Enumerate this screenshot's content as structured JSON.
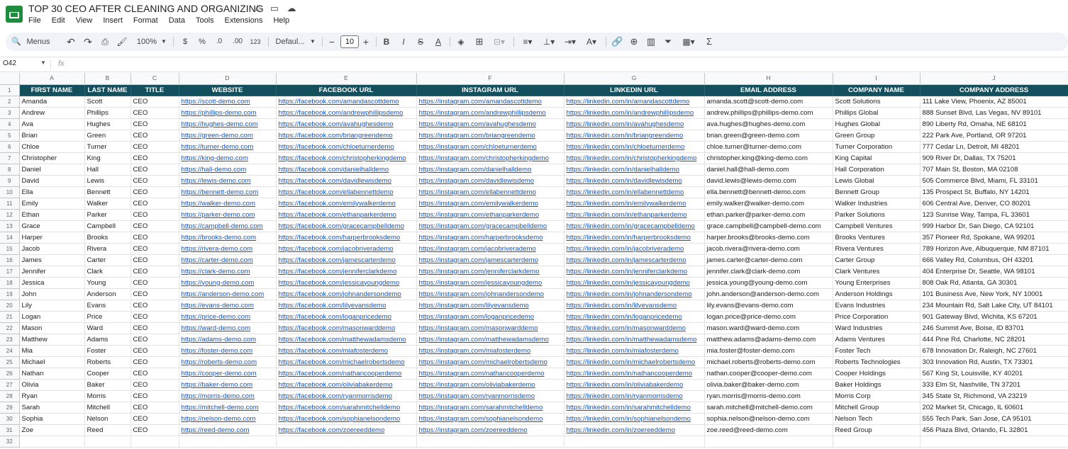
{
  "doc_title": "TOP 30 CEO AFTER CLEANING AND ORGANIZING",
  "menu": [
    "File",
    "Edit",
    "View",
    "Insert",
    "Format",
    "Data",
    "Tools",
    "Extensions",
    "Help"
  ],
  "toolbar": {
    "menus_label": "Menus",
    "zoom": "100%",
    "currency": "$",
    "percent": "%",
    "dec_decrease": ".0",
    "dec_increase": ".00",
    "number_format": "123",
    "font": "Defaul...",
    "font_size": "10",
    "bold": "B",
    "italic": "I"
  },
  "name_box": "O42",
  "fx": "fx",
  "columns": [
    "A",
    "B",
    "C",
    "D",
    "E",
    "F",
    "G",
    "H",
    "I",
    "J"
  ],
  "headers": [
    "FIRST NAME",
    "LAST NAME",
    "TITLE",
    "WEBSITE",
    "FACEBOOK URL",
    "INSTAGRAM URL",
    "LINKEDIN URL",
    "EMAIL ADDRESS",
    "COMPANY NAME",
    "COMPANY ADDRESS"
  ],
  "rows": [
    [
      "Amanda",
      "Scott",
      "CEO",
      "https://scott-demo.com",
      "https://facebook.com/amandascottdemo",
      "https://instagram.com/amandascottdemo",
      "https://linkedin.com/in/amandascottdemo",
      "amanda.scott@scott-demo.com",
      "Scott Solutions",
      "111 Lake View, Phoenix, AZ 85001"
    ],
    [
      "Andrew",
      "Phillips",
      "CEO",
      "https://phillips-demo.com",
      "https://facebook.com/andrewphillipsdemo",
      "https://instagram.com/andrewphillipsdemo",
      "https://linkedin.com/in/andrewphillipsdemo",
      "andrew.phillips@phillips-demo.com",
      "Phillips Global",
      "888 Sunset Blvd, Las Vegas, NV 89101"
    ],
    [
      "Ava",
      "Hughes",
      "CEO",
      "https://hughes-demo.com",
      "https://facebook.com/avahughesdemo",
      "https://instagram.com/avahughesdemo",
      "https://linkedin.com/in/avahughesdemo",
      "ava.hughes@hughes-demo.com",
      "Hughes Global",
      "890 Liberty Rd, Omaha, NE 68101"
    ],
    [
      "Brian",
      "Green",
      "CEO",
      "https://green-demo.com",
      "https://facebook.com/briangreendemo",
      "https://instagram.com/briangreendemo",
      "https://linkedin.com/in/briangreendemo",
      "brian.green@green-demo.com",
      "Green Group",
      "222 Park Ave, Portland, OR 97201"
    ],
    [
      "Chloe",
      "Turner",
      "CEO",
      "https://turner-demo.com",
      "https://facebook.com/chloeturnerdemo",
      "https://instagram.com/chloeturnerdemo",
      "https://linkedin.com/in/chloeturnerdemo",
      "chloe.turner@turner-demo.com",
      "Turner Corporation",
      "777 Cedar Ln, Detroit, MI 48201"
    ],
    [
      "Christopher",
      "King",
      "CEO",
      "https://king-demo.com",
      "https://facebook.com/christopherkingdemo",
      "https://instagram.com/christopherkingdemo",
      "https://linkedin.com/in/christopherkingdemo",
      "christopher.king@king-demo.com",
      "King Capital",
      "909 River Dr, Dallas, TX 75201"
    ],
    [
      "Daniel",
      "Hall",
      "CEO",
      "https://hall-demo.com",
      "https://facebook.com/danielhalldemo",
      "https://instagram.com/danielhalldemo",
      "https://linkedin.com/in/danielhalldemo",
      "daniel.hall@hall-demo.com",
      "Hall Corporation",
      "707 Main St, Boston, MA 02108"
    ],
    [
      "David",
      "Lewis",
      "CEO",
      "https://lewis-demo.com",
      "https://facebook.com/davidlewisdemo",
      "https://instagram.com/davidlewisdemo",
      "https://linkedin.com/in/davidlewisdemo",
      "david.lewis@lewis-demo.com",
      "Lewis Global",
      "505 Commerce Blvd, Miami, FL 33101"
    ],
    [
      "Ella",
      "Bennett",
      "CEO",
      "https://bennett-demo.com",
      "https://facebook.com/ellabennettdemo",
      "https://instagram.com/ellabennettdemo",
      "https://linkedin.com/in/ellabennettdemo",
      "ella.bennett@bennett-demo.com",
      "Bennett Group",
      "135 Prospect St, Buffalo, NY 14201"
    ],
    [
      "Emily",
      "Walker",
      "CEO",
      "https://walker-demo.com",
      "https://facebook.com/emilywalkerdemo",
      "https://instagram.com/emilywalkerdemo",
      "https://linkedin.com/in/emilywalkerdemo",
      "emily.walker@walker-demo.com",
      "Walker Industries",
      "606 Central Ave, Denver, CO 80201"
    ],
    [
      "Ethan",
      "Parker",
      "CEO",
      "https://parker-demo.com",
      "https://facebook.com/ethanparkerdemo",
      "https://instagram.com/ethanparkerdemo",
      "https://linkedin.com/in/ethanparkerdemo",
      "ethan.parker@parker-demo.com",
      "Parker Solutions",
      "123 Sunrise Way, Tampa, FL 33601"
    ],
    [
      "Grace",
      "Campbell",
      "CEO",
      "https://campbell-demo.com",
      "https://facebook.com/gracecampbelldemo",
      "https://instagram.com/gracecampbelldemo",
      "https://linkedin.com/in/gracecampbelldemo",
      "grace.campbell@campbell-demo.com",
      "Campbell Ventures",
      "999 Harbor Dr, San Diego, CA 92101"
    ],
    [
      "Harper",
      "Brooks",
      "CEO",
      "https://brooks-demo.com",
      "https://facebook.com/harperbrooksdemo",
      "https://instagram.com/harperbrooksdemo",
      "https://linkedin.com/in/harperbrooksdemo",
      "harper.brooks@brooks-demo.com",
      "Brooks Ventures",
      "357 Pioneer Rd, Spokane, WA 99201"
    ],
    [
      "Jacob",
      "Rivera",
      "CEO",
      "https://rivera-demo.com",
      "https://facebook.com/jacobriverademo",
      "https://instagram.com/jacobriverademo",
      "https://linkedin.com/in/jacobriverademo",
      "jacob.rivera@rivera-demo.com",
      "Rivera Ventures",
      "789 Horizon Ave, Albuquerque, NM 87101"
    ],
    [
      "James",
      "Carter",
      "CEO",
      "https://carter-demo.com",
      "https://facebook.com/jamescarterdemo",
      "https://instagram.com/jamescarterdemo",
      "https://linkedin.com/in/jamescarterdemo",
      "james.carter@carter-demo.com",
      "Carter Group",
      "666 Valley Rd, Columbus, OH 43201"
    ],
    [
      "Jennifer",
      "Clark",
      "CEO",
      "https://clark-demo.com",
      "https://facebook.com/jenniferclarkdemo",
      "https://instagram.com/jenniferclarkdemo",
      "https://linkedin.com/in/jenniferclarkdemo",
      "jennifer.clark@clark-demo.com",
      "Clark Ventures",
      "404 Enterprise Dr, Seattle, WA 98101"
    ],
    [
      "Jessica",
      "Young",
      "CEO",
      "https://young-demo.com",
      "https://facebook.com/jessicayoungdemo",
      "https://instagram.com/jessicayoungdemo",
      "https://linkedin.com/in/jessicayoungdemo",
      "jessica.young@young-demo.com",
      "Young Enterprises",
      "808 Oak Rd, Atlanta, GA 30301"
    ],
    [
      "John",
      "Anderson",
      "CEO",
      "https://anderson-demo.com",
      "https://facebook.com/johnandersondemo",
      "https://instagram.com/johnandersondemo",
      "https://linkedin.com/in/johnandersondemo",
      "john.anderson@anderson-demo.com",
      "Anderson Holdings",
      "101 Business Ave, New York, NY 10001"
    ],
    [
      "Lily",
      "Evans",
      "CEO",
      "https://evans-demo.com",
      "https://facebook.com/lilyevansdemo",
      "https://instagram.com/lilyevansdemo",
      "https://linkedin.com/in/lilyevansdemo",
      "lily.evans@evans-demo.com",
      "Evans Industries",
      "234 Mountain Rd, Salt Lake City, UT 84101"
    ],
    [
      "Logan",
      "Price",
      "CEO",
      "https://price-demo.com",
      "https://facebook.com/loganpricedemo",
      "https://instagram.com/loganpricedemo",
      "https://linkedin.com/in/loganpricedemo",
      "logan.price@price-demo.com",
      "Price Corporation",
      "901 Gateway Blvd, Wichita, KS 67201"
    ],
    [
      "Mason",
      "Ward",
      "CEO",
      "https://ward-demo.com",
      "https://facebook.com/masonwarddemo",
      "https://instagram.com/masonwarddemo",
      "https://linkedin.com/in/masonwarddemo",
      "mason.ward@ward-demo.com",
      "Ward Industries",
      "246 Summit Ave, Boise, ID 83701"
    ],
    [
      "Matthew",
      "Adams",
      "CEO",
      "https://adams-demo.com",
      "https://facebook.com/matthewadamsdemo",
      "https://instagram.com/matthewadamsdemo",
      "https://linkedin.com/in/matthewadamsdemo",
      "matthew.adams@adams-demo.com",
      "Adams Ventures",
      "444 Pine Rd, Charlotte, NC 28201"
    ],
    [
      "Mia",
      "Foster",
      "CEO",
      "https://foster-demo.com",
      "https://facebook.com/miafosterdemo",
      "https://instagram.com/miafosterdemo",
      "https://linkedin.com/in/miafosterdemo",
      "mia.foster@foster-demo.com",
      "Foster Tech",
      "678 Innovation Dr, Raleigh, NC 27601"
    ],
    [
      "Michael",
      "Roberts",
      "CEO",
      "https://roberts-demo.com",
      "https://facebook.com/michaelrobertsdemo",
      "https://instagram.com/michaelrobertsdemo",
      "https://linkedin.com/in/michaelrobertsdemo",
      "michael.roberts@roberts-demo.com",
      "Roberts Technologies",
      "303 Innovation Rd, Austin, TX 73301"
    ],
    [
      "Nathan",
      "Cooper",
      "CEO",
      "https://cooper-demo.com",
      "https://facebook.com/nathancooperdemo",
      "https://instagram.com/nathancooperdemo",
      "https://linkedin.com/in/nathancooperdemo",
      "nathan.cooper@cooper-demo.com",
      "Cooper Holdings",
      "567 King St, Louisville, KY 40201"
    ],
    [
      "Olivia",
      "Baker",
      "CEO",
      "https://baker-demo.com",
      "https://facebook.com/oliviabakerdemo",
      "https://instagram.com/oliviabakerdemo",
      "https://linkedin.com/in/oliviabakerdemo",
      "olivia.baker@baker-demo.com",
      "Baker Holdings",
      "333 Elm St, Nashville, TN 37201"
    ],
    [
      "Ryan",
      "Morris",
      "CEO",
      "https://morris-demo.com",
      "https://facebook.com/ryanmorrisdemo",
      "https://instagram.com/ryanmorrisdemo",
      "https://linkedin.com/in/ryanmorrisdemo",
      "ryan.morris@morris-demo.com",
      "Morris Corp",
      "345 State St, Richmond, VA 23219"
    ],
    [
      "Sarah",
      "Mitchell",
      "CEO",
      "https://mitchell-demo.com",
      "https://facebook.com/sarahmitchelldemo",
      "https://instagram.com/sarahmitchelldemo",
      "https://linkedin.com/in/sarahmitchelldemo",
      "sarah.mitchell@mitchell-demo.com",
      "Mitchell Group",
      "202 Market St, Chicago, IL 60601"
    ],
    [
      "Sophia",
      "Nelson",
      "CEO",
      "https://nelson-demo.com",
      "https://facebook.com/sophianelsondemo",
      "https://instagram.com/sophianelsondemo",
      "https://linkedin.com/in/sophianelsondemo",
      "sophia.nelson@nelson-demo.com",
      "Nelson Tech",
      "555 Tech Park, San Jose, CA 95101"
    ],
    [
      "Zoe",
      "Reed",
      "CEO",
      "https://reed-demo.com",
      "https://facebook.com/zoereeddemo",
      "https://instagram.com/zoereeddemo",
      "https://linkedin.com/in/zoereeddemo",
      "zoe.reed@reed-demo.com",
      "Reed Group",
      "456 Plaza Blvd, Orlando, FL 32801"
    ]
  ],
  "header_color": "#134f5c",
  "link_color": "#1155cc",
  "icons": [
    "star-icon",
    "move-folder-icon",
    "cloud-status-icon",
    "search-icon",
    "undo-icon",
    "redo-icon",
    "print-icon",
    "paint-format-icon",
    "strikethrough-icon",
    "text-color-icon",
    "fill-color-icon",
    "borders-icon",
    "merge-cells-icon",
    "align-icon",
    "valign-icon",
    "text-wrap-icon",
    "text-rotate-icon",
    "link-icon",
    "comment-icon",
    "chart-icon",
    "filter-icon",
    "filter-views-icon",
    "functions-icon"
  ]
}
